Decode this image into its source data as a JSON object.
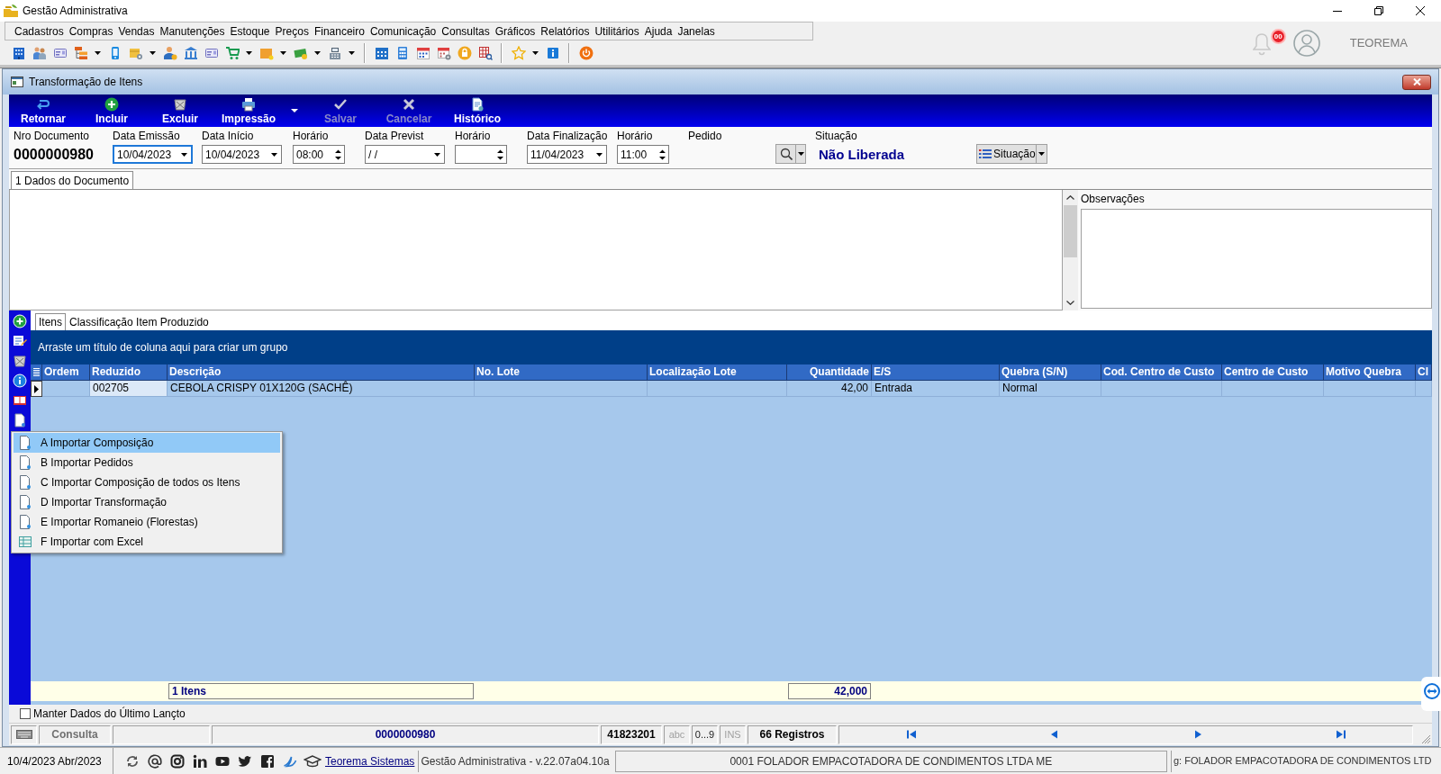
{
  "window": {
    "title": "Gestão Administrativa"
  },
  "menu_bar": [
    "Cadastros",
    "Compras",
    "Vendas",
    "Manutenções",
    "Estoque",
    "Preços",
    "Financeiro",
    "Comunicação",
    "Consultas",
    "Gráficos",
    "Relatórios",
    "Utilitários",
    "Ajuda",
    "Janelas"
  ],
  "header": {
    "notification_badge": "00",
    "user": "TEOREMA"
  },
  "document_window": {
    "title": "Transformação de Itens",
    "toolbar": [
      {
        "label": "Retornar",
        "disabled": false,
        "dropdown": false
      },
      {
        "label": "Incluir",
        "disabled": false,
        "dropdown": false
      },
      {
        "label": "Excluir",
        "disabled": false,
        "dropdown": false
      },
      {
        "label": "Impressão",
        "disabled": false,
        "dropdown": true
      },
      {
        "label": "Salvar",
        "disabled": true,
        "dropdown": false
      },
      {
        "label": "Cancelar",
        "disabled": true,
        "dropdown": false
      },
      {
        "label": "Histórico",
        "disabled": false,
        "dropdown": false
      }
    ],
    "fields": [
      {
        "kind": "number",
        "label": "Nro Documento",
        "value": "0000000980",
        "focused": false
      },
      {
        "kind": "date",
        "label": "Data Emissão",
        "value": "10/04/2023",
        "focused": true
      },
      {
        "kind": "date",
        "label": "Data Início",
        "value": "10/04/2023",
        "focused": false
      },
      {
        "kind": "time",
        "label": "Horário",
        "value": "08:00",
        "focused": false
      },
      {
        "kind": "date",
        "label": "Data Previst",
        "value": "/ /",
        "focused": false
      },
      {
        "kind": "time",
        "label": "Horário",
        "focused": false
      },
      {
        "kind": "date",
        "label": "Data Finalização",
        "value": "11/04/2023",
        "focused": false
      },
      {
        "kind": "time",
        "label": "Horário",
        "value": "11:00",
        "focused": false
      },
      {
        "kind": "lookup",
        "label": "Pedido",
        "focused": false
      },
      {
        "kind": "status",
        "label": "Situação",
        "value": "Não Liberada",
        "focused": false
      }
    ],
    "status_button": {
      "label": "Situação"
    },
    "tabs": [
      {
        "label": "1 Dados do Documento",
        "selected": true
      }
    ],
    "observations": {
      "label": "Observações"
    },
    "item_tabs": [
      {
        "label": "Itens",
        "selected": true
      },
      {
        "label": "Classificação Item Produzido",
        "selected": false
      }
    ],
    "group_panel": {
      "hint": "Arraste um título de coluna aqui para criar um grupo"
    },
    "table": {
      "columns": [
        {
          "label": "Ordem",
          "kind": "text"
        },
        {
          "label": "Reduzido",
          "kind": "text"
        },
        {
          "label": "Descrição",
          "kind": "text",
          "summary": "1 Itens"
        },
        {
          "label": "No. Lote",
          "kind": "text"
        },
        {
          "label": "Localização Lote",
          "kind": "text"
        },
        {
          "label": "Quantidade",
          "kind": "number",
          "summary": "42,000"
        },
        {
          "label": "E/S",
          "kind": "text"
        },
        {
          "label": "Quebra (S/N)",
          "kind": "text"
        },
        {
          "label": "Cod. Centro de Custo",
          "kind": "text"
        },
        {
          "label": "Centro de Custo",
          "kind": "text"
        },
        {
          "label": "Motivo Quebra",
          "kind": "text"
        },
        {
          "label": "Cl",
          "kind": "text"
        }
      ],
      "rows": [
        {
          "current": true,
          "cells": [
            {
              "focused": false
            },
            {
              "text": "002705",
              "focused": true
            },
            {
              "text": "CEBOLA CRISPY 01X120G (SACHÊ)",
              "focused": false
            },
            {
              "focused": false
            },
            {
              "focused": false
            },
            {
              "text": "42,00",
              "focused": false
            },
            {
              "text": "Entrada",
              "focused": false
            },
            {
              "text": "Normal",
              "focused": false
            },
            {
              "focused": false
            },
            {
              "focused": false
            },
            {
              "focused": false
            },
            {
              "focused": false
            }
          ]
        }
      ]
    },
    "context_menu": [
      {
        "kind": "document",
        "label": "A Importar Composição",
        "selected": true
      },
      {
        "kind": "document",
        "label": "B Importar Pedidos",
        "selected": false
      },
      {
        "kind": "document",
        "label": "C Importar Composição de todos os Itens",
        "selected": false
      },
      {
        "kind": "document",
        "label": "D Importar Transformação",
        "selected": false
      },
      {
        "kind": "document",
        "label": "E Importar Romaneio (Florestas)",
        "selected": false
      },
      {
        "kind": "spreadsheet",
        "label": "F Importar com Excel",
        "selected": false
      }
    ],
    "keep_data": {
      "label": "Manter Dados do Último Lançto",
      "checked": false
    },
    "status_bar": {
      "mode": "Consulta",
      "document": "0000000980",
      "code": "41823201",
      "indicators": [
        {
          "label": "abc",
          "active": false
        },
        {
          "label": "0...9",
          "active": true
        },
        {
          "label": "INS",
          "active": false
        }
      ],
      "records": "66 Registros"
    }
  },
  "footer_bar": {
    "date": "10/4/2023 Abr/2023",
    "link": "Teorema Sistemas",
    "version": "Gestão Administrativa - v.22.07a04.10a",
    "company": "0001 FOLADOR EMPACOTADORA DE CONDIMENTOS LTDA ME",
    "company_cut": "g: FOLADOR EMPACOTADORA DE CONDIMENTOS LTD"
  }
}
